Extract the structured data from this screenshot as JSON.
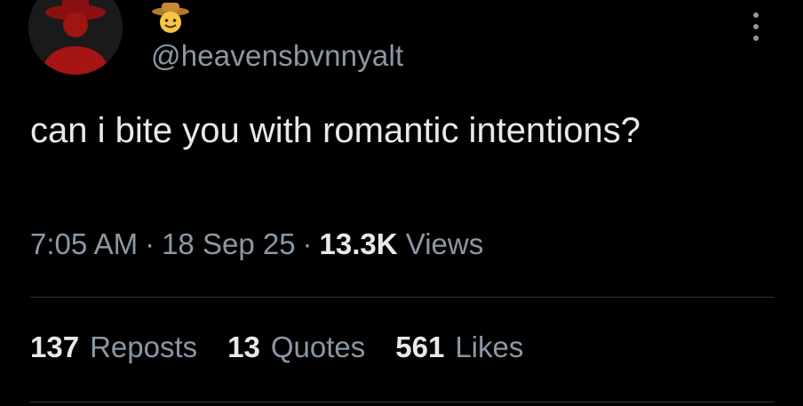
{
  "author": {
    "avatar_icon": "cowboy-hat-red-figure-avatar",
    "display_name_icon": "cowboy-hat-face-emoji",
    "handle": "@heavensbvnnyalt"
  },
  "tweet": {
    "text": "can i bite you with romantic intentions?",
    "time": "7:05 AM",
    "date": "18 Sep 25",
    "separator": "·",
    "views_count": "13.3K",
    "views_label": "Views"
  },
  "stats": {
    "reposts_count": "137",
    "reposts_label": "Reposts",
    "quotes_count": "13",
    "quotes_label": "Quotes",
    "likes_count": "561",
    "likes_label": "Likes"
  },
  "colors": {
    "background": "#000000",
    "primary_text": "#e7e9ea",
    "secondary_text": "#8b98a5",
    "divider": "#2f3336"
  }
}
